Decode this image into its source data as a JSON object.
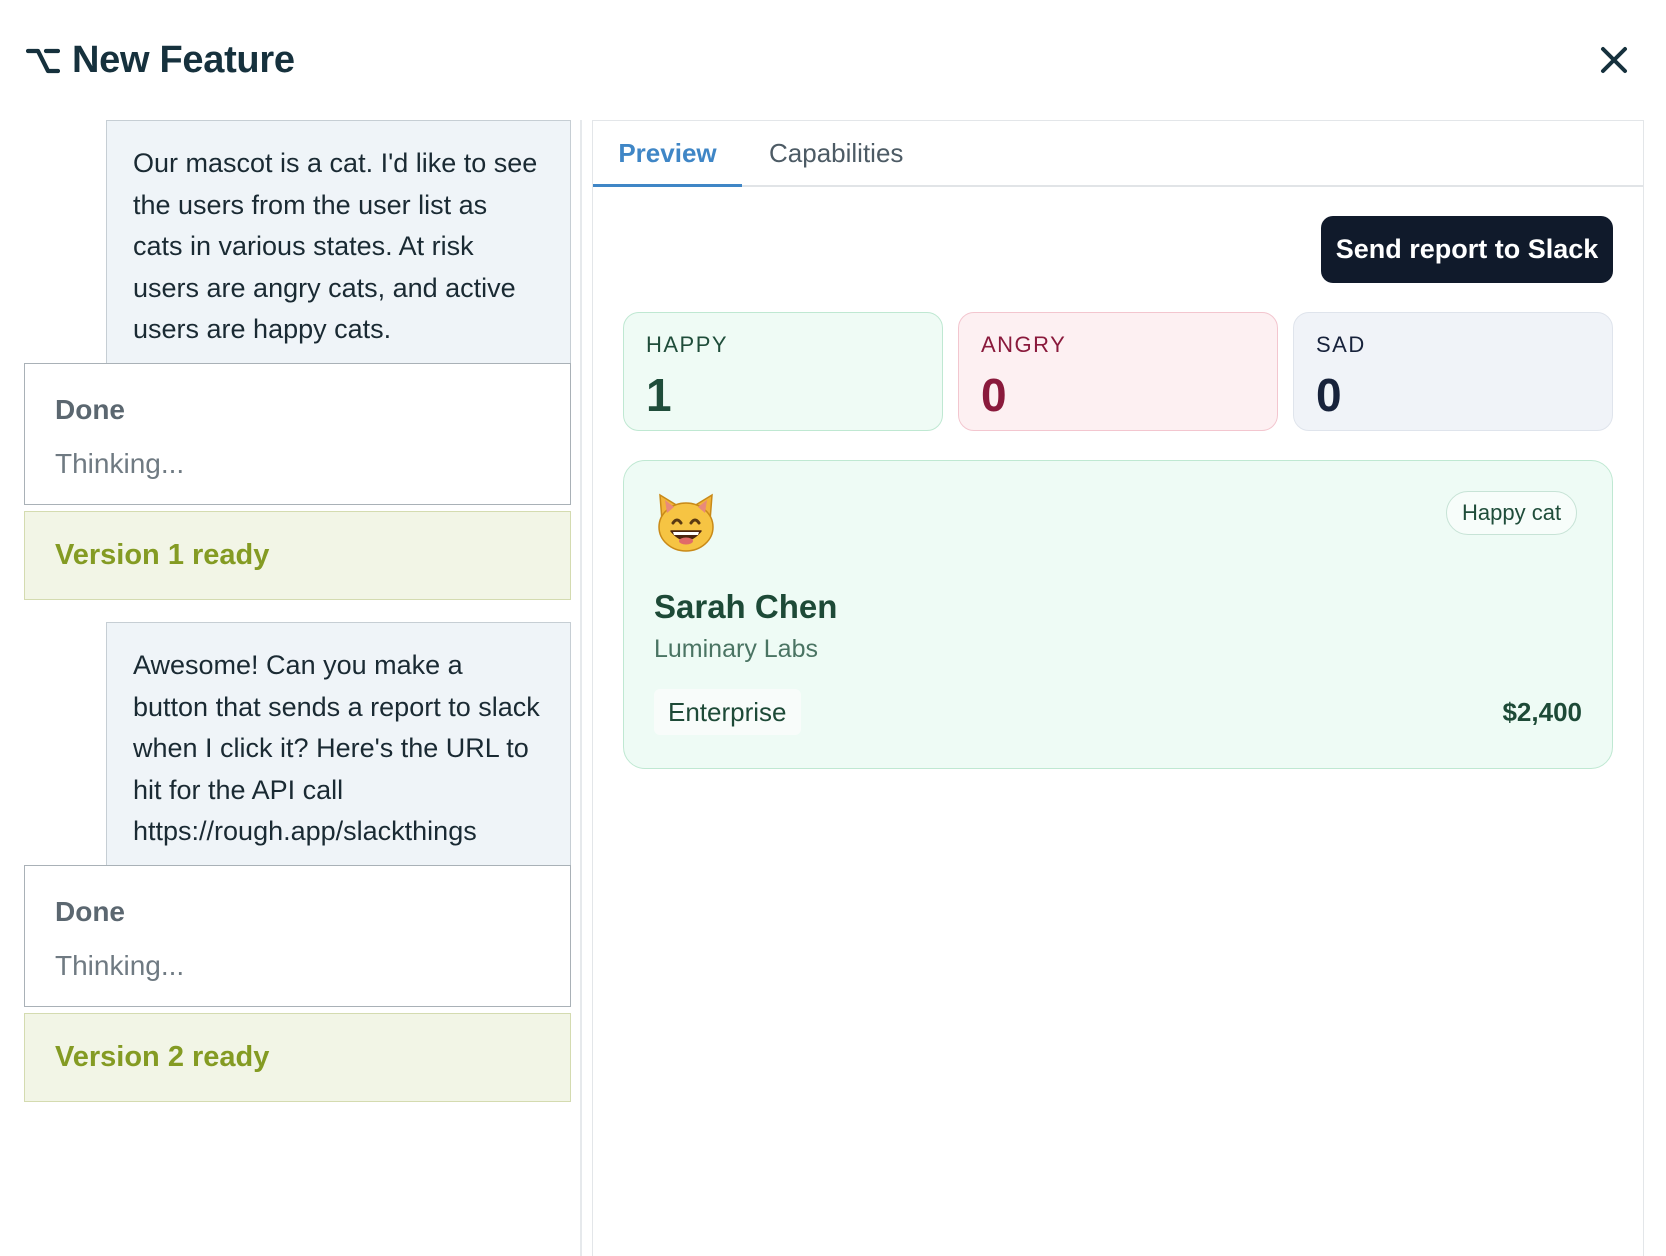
{
  "header": {
    "title": "New Feature",
    "logo_icon": "option-key-icon",
    "close_icon": "close-icon"
  },
  "conversation": {
    "messages": [
      {
        "role": "user",
        "text": "Our mascot is a cat. I'd like to see the users from the user list as cats in various states. At risk users are angry cats, and active users are happy cats."
      },
      {
        "role": "status",
        "title": "Done",
        "subtitle": "Thinking..."
      },
      {
        "role": "version",
        "text": "Version 1 ready"
      },
      {
        "role": "user",
        "text": "Awesome! Can you make a button that sends a report to slack when I click it? Here's the URL to hit for the API call https://rough.app/slackthings"
      },
      {
        "role": "status",
        "title": "Done",
        "subtitle": "Thinking..."
      },
      {
        "role": "version",
        "text": "Version 2 ready"
      }
    ]
  },
  "preview": {
    "tabs": [
      {
        "label": "Preview",
        "active": true
      },
      {
        "label": "Capabilities",
        "active": false
      }
    ],
    "slack_button_label": "Send report to Slack",
    "stats": [
      {
        "label": "HAPPY",
        "value": "1"
      },
      {
        "label": "ANGRY",
        "value": "0"
      },
      {
        "label": "SAD",
        "value": "0"
      }
    ],
    "users": [
      {
        "avatar_icon": "happy-cat-face-icon",
        "mood": "Happy cat",
        "name": "Sarah Chen",
        "company": "Luminary Labs",
        "plan": "Enterprise",
        "amount": "$2,400"
      }
    ]
  },
  "colors": {
    "accent_blue": "#3f86c6",
    "button_dark": "#101a2b",
    "happy_green": "#1f4d3a",
    "angry_red": "#8a1a3c",
    "version_olive": "#849b23"
  }
}
